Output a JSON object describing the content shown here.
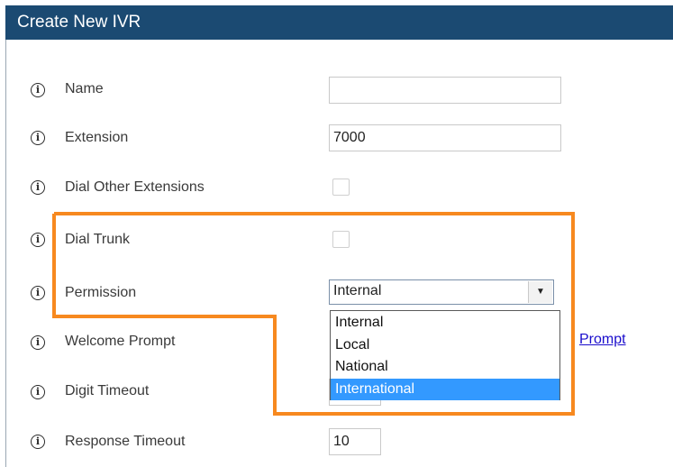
{
  "dialog": {
    "title": "Create New IVR"
  },
  "fields": {
    "name": {
      "label": "Name",
      "value": ""
    },
    "extension": {
      "label": "Extension",
      "value": "7000"
    },
    "dial_other_extensions": {
      "label": "Dial Other Extensions",
      "checked": false
    },
    "dial_trunk": {
      "label": "Dial Trunk",
      "checked": false
    },
    "permission": {
      "label": "Permission",
      "selected": "Internal",
      "options": [
        "Internal",
        "Local",
        "National",
        "International"
      ],
      "highlighted_option": "International"
    },
    "welcome_prompt": {
      "label": "Welcome Prompt",
      "link_text": "Prompt"
    },
    "digit_timeout": {
      "label": "Digit Timeout"
    },
    "response_timeout": {
      "label": "Response Timeout",
      "value": "10"
    }
  },
  "icons": {
    "info": "info-icon",
    "dropdown_arrow": "triangle-down-icon"
  },
  "colors": {
    "title_bar": "#1b4a72",
    "highlight_outline": "#f7891f",
    "selected_option": "#3399ff",
    "link": "#1a0dcc"
  }
}
